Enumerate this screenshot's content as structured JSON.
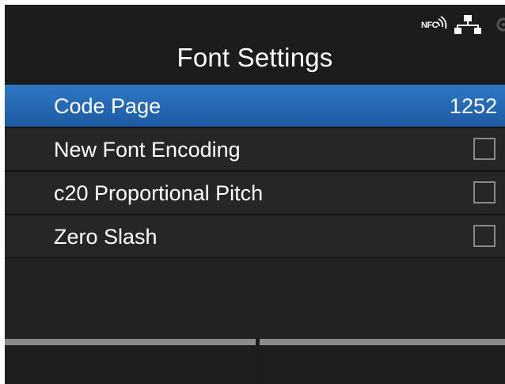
{
  "status_bar": {
    "nfc_label": "NFC",
    "icons": [
      "nfc-icon",
      "network-icon",
      "gear-icon"
    ]
  },
  "title": "Font Settings",
  "menu": {
    "items": [
      {
        "label": "Code Page",
        "value": "1252",
        "selected": true
      },
      {
        "label": "New Font Encoding",
        "checked": false
      },
      {
        "label": "c20 Proportional Pitch",
        "checked": false
      },
      {
        "label": "Zero Slash",
        "checked": false
      }
    ]
  },
  "softkeys": {
    "left_label": "",
    "right_label": ""
  },
  "colors": {
    "background": "#1c1c1c",
    "selected_row": "#2468b4",
    "text": "#ffffff",
    "checkbox_border": "#8a8a8a"
  }
}
